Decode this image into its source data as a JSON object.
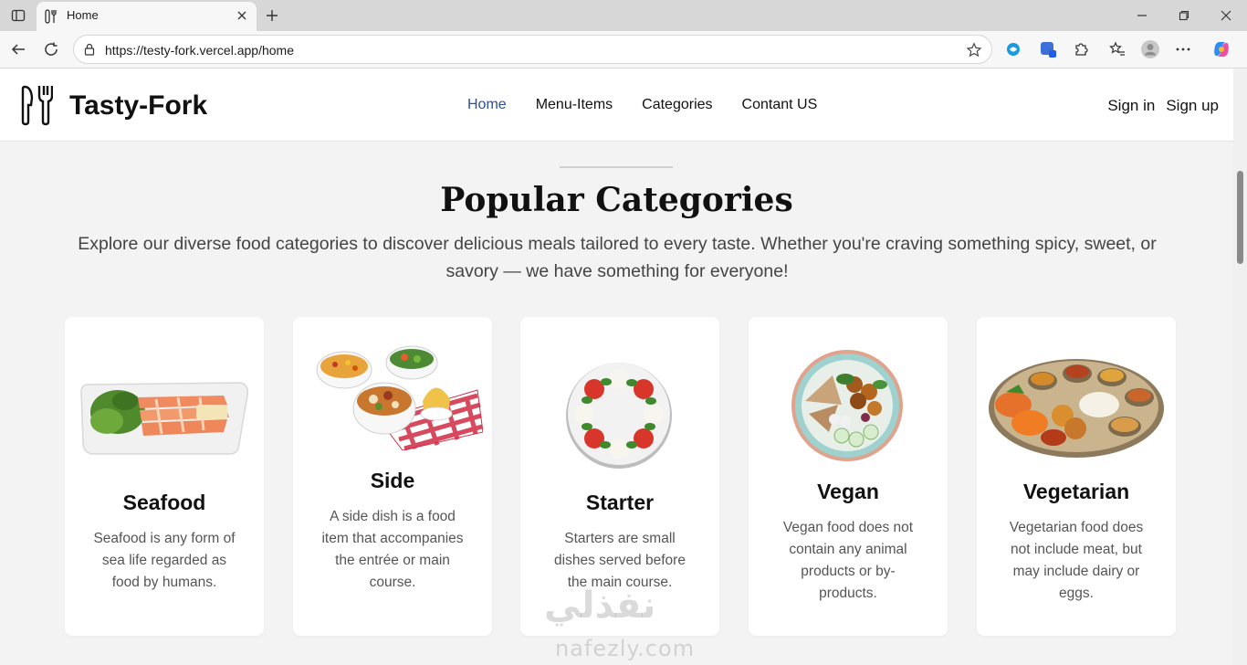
{
  "browser": {
    "tab_title": "Home",
    "url": "https://testy-fork.vercel.app/home"
  },
  "site": {
    "brand": "Tasty-Fork",
    "nav": [
      {
        "label": "Home",
        "active": true
      },
      {
        "label": "Menu-Items",
        "active": false
      },
      {
        "label": "Categories",
        "active": false
      },
      {
        "label": "Contant US",
        "active": false
      }
    ],
    "auth": {
      "sign_in": "Sign in",
      "sign_up": "Sign up"
    },
    "accent_color": "#2d4fa1"
  },
  "section": {
    "title": "Popular Categories",
    "description": "Explore our diverse food categories to discover delicious meals tailored to every taste. Whether you're craving something spicy, sweet, or savory — we have something for everyone!"
  },
  "categories": [
    {
      "name": "Seafood",
      "description": "Seafood is any form of sea life regarded as food by humans.",
      "image": "salmon-plate-image"
    },
    {
      "name": "Side",
      "description": "A side dish is a food item that accompanies the entrée or main course.",
      "image": "side-dishes-image"
    },
    {
      "name": "Starter",
      "description": "Starters are small dishes served before the main course.",
      "image": "caprese-plate-image"
    },
    {
      "name": "Vegan",
      "description": "Vegan food does not contain any animal products or by-products.",
      "image": "vegan-bowl-image"
    },
    {
      "name": "Vegetarian",
      "description": "Vegetarian food does not include meat, but may include dairy or eggs.",
      "image": "thali-platter-image"
    }
  ],
  "watermark": {
    "script": "نفذلي",
    "latin": "nafezly.com"
  }
}
